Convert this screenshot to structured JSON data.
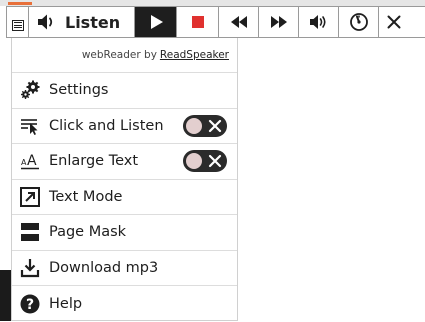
{
  "toolbar": {
    "listen_label": "Listen",
    "icons": [
      "menu-icon",
      "speaker-icon",
      "play-icon",
      "stop-icon",
      "rewind-icon",
      "fast-forward-icon",
      "volume-icon",
      "speed-icon",
      "close-icon"
    ]
  },
  "menu": {
    "brand_prefix": "webReader by",
    "brand_link": "ReadSpeaker",
    "items": [
      {
        "label": "Settings",
        "icon": "gears-icon"
      },
      {
        "label": "Click and Listen",
        "icon": "click-listen-icon",
        "toggle": "off"
      },
      {
        "label": "Enlarge Text",
        "icon": "enlarge-text-icon",
        "toggle": "off"
      },
      {
        "label": "Text Mode",
        "icon": "text-mode-icon"
      },
      {
        "label": "Page Mask",
        "icon": "page-mask-icon"
      },
      {
        "label": "Download mp3",
        "icon": "download-icon"
      },
      {
        "label": "Help",
        "icon": "help-icon"
      }
    ]
  },
  "colors": {
    "stop": "#e0312f",
    "play_bg": "#1e1e1e",
    "accent": "#e8703a",
    "toggle_bg": "#2b2b2b",
    "toggle_knob": "#e3cfcf"
  }
}
